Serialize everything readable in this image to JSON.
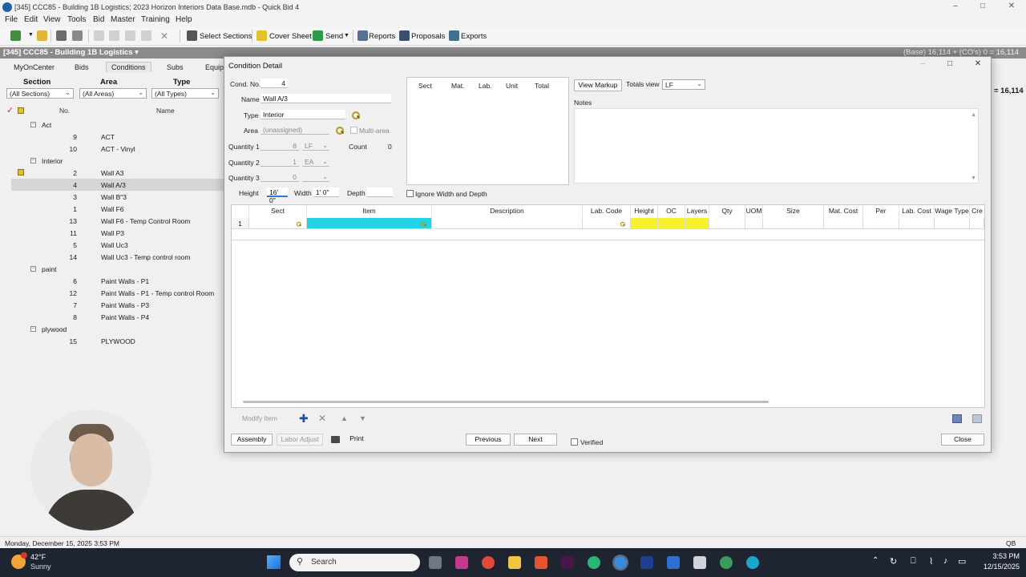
{
  "window": {
    "title": "[345] CCC85 - Building 1B Logistics; 2023 Horizon Interiors Data Base.mdb - Quick Bid 4"
  },
  "menu": [
    "File",
    "Edit",
    "View",
    "Tools",
    "Bid",
    "Master",
    "Training",
    "Help"
  ],
  "toolbar": {
    "select_sections": "Select Sections",
    "cover_sheet": "Cover Sheet",
    "send": "Send",
    "reports": "Reports",
    "proposals": "Proposals",
    "exports": "Exports"
  },
  "path": {
    "bid": "[345] CCC85 - Building 1B Logistics",
    "base": "(Base) 16,114 + (CO's) 0 = 16,114",
    "right_total": "= 16,114"
  },
  "tabs": [
    "MyOnCenter",
    "Bids",
    "Conditions",
    "Subs",
    "Equip"
  ],
  "filters": {
    "section_label": "Section",
    "area_label": "Area",
    "type_label": "Type",
    "section_value": "(All Sections)",
    "area_value": "(All Areas)",
    "type_value": "(All Types)"
  },
  "list": {
    "col_no": "No.",
    "col_name": "Name",
    "groups": [
      {
        "label": "Act",
        "items": [
          {
            "no": "9",
            "name": "ACT"
          },
          {
            "no": "10",
            "name": "ACT - Vinyl"
          }
        ]
      },
      {
        "label": "Interior",
        "items": [
          {
            "no": "2",
            "name": "Wall A3"
          },
          {
            "no": "4",
            "name": "Wall A/3"
          },
          {
            "no": "3",
            "name": "Wall B\"3"
          },
          {
            "no": "1",
            "name": "Wall F6"
          },
          {
            "no": "13",
            "name": "Wall F6 - Temp Control Room"
          },
          {
            "no": "11",
            "name": "Wall P3"
          },
          {
            "no": "5",
            "name": "Wall Uc3"
          },
          {
            "no": "14",
            "name": "Wall Uc3 - Temp control room"
          }
        ]
      },
      {
        "label": "paint",
        "items": [
          {
            "no": "6",
            "name": "Paint Walls - P1"
          },
          {
            "no": "12",
            "name": "Paint Walls - P1 - Temp control Room"
          },
          {
            "no": "7",
            "name": "Paint Walls - P3"
          },
          {
            "no": "8",
            "name": "Paint Walls - P4"
          }
        ]
      },
      {
        "label": "plywood",
        "items": [
          {
            "no": "15",
            "name": "PLYWOOD"
          }
        ]
      }
    ]
  },
  "dialog": {
    "title": "Condition Detail",
    "cond_no_label": "Cond. No.",
    "cond_no": "4",
    "name_label": "Name",
    "name": "Wall A/3",
    "type_label": "Type",
    "type": "Interior",
    "area_label": "Area",
    "area": "(unassigned)",
    "multi_area": "Multi-area",
    "qty1_label": "Quantity 1",
    "qty1": "8",
    "qty1_unit": "LF",
    "count_label": "Count",
    "count": "0",
    "qty2_label": "Quantity 2",
    "qty2": "1",
    "qty2_unit": "EA",
    "qty3_label": "Quantity 3",
    "qty3": "0",
    "height_label": "Height",
    "height": "16' 0\"",
    "width_label": "Width",
    "width": "1' 0\"",
    "depth_label": "Depth",
    "ignore_wd": "Ignore Width and Depth",
    "summary_cols": [
      "Sect",
      "Mat.",
      "Lab.",
      "Unit",
      "Total"
    ],
    "view_markup": "View Markup",
    "totals_view_label": "Totals view",
    "totals_view": "LF",
    "notes_label": "Notes",
    "grid_cols": [
      "Sect",
      "Item",
      "Description",
      "Lab. Code",
      "Height",
      "OC",
      "Layers",
      "Qty",
      "UOM",
      "Size",
      "Mat. Cost",
      "Per",
      "Lab. Cost",
      "Wage Type",
      "Cre"
    ],
    "row_number": "1",
    "modify_item": "Modify Item",
    "assembly": "Assembly",
    "labor_adjust": "Labor Adjust",
    "print": "Print",
    "previous": "Previous",
    "next": "Next",
    "verified": "Verified",
    "close": "Close"
  },
  "status": {
    "datetime": "Monday, December 15, 2025 3:53 PM",
    "right": "QB"
  },
  "taskbar": {
    "weather_temp": "42°F",
    "weather_desc": "Sunny",
    "search": "Search",
    "time": "3:53 PM",
    "date": "12/15/2025"
  }
}
